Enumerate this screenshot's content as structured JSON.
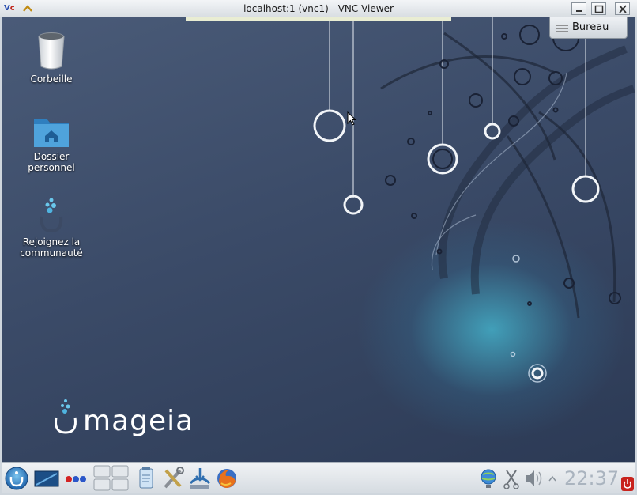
{
  "window": {
    "title": "localhost:1 (vnc1) - VNC Viewer",
    "logo_v": "V",
    "logo_c": "c"
  },
  "desktop": {
    "icons": [
      {
        "label_line1": "Corbeille",
        "label_line2": ""
      },
      {
        "label_line1": "Dossier",
        "label_line2": "personnel"
      },
      {
        "label_line1": "Rejoignez la",
        "label_line2": "communauté"
      }
    ],
    "bureau_button": "Bureau",
    "brand_text": "mageia"
  },
  "taskbar": {
    "clock": "22:37",
    "icons": [
      "mageia-menu-icon",
      "show-desktop-icon",
      "color-dots-icon",
      "pager-icon",
      "clipboard-icon",
      "tools-icon",
      "network-install-icon",
      "firefox-icon",
      "network-globe-icon",
      "scissors-icon",
      "volume-icon",
      "tray-expand-icon",
      "power-icon"
    ]
  },
  "colors": {
    "accent_teal": "#46bed7",
    "desktop_bg": "#3b4b68"
  }
}
